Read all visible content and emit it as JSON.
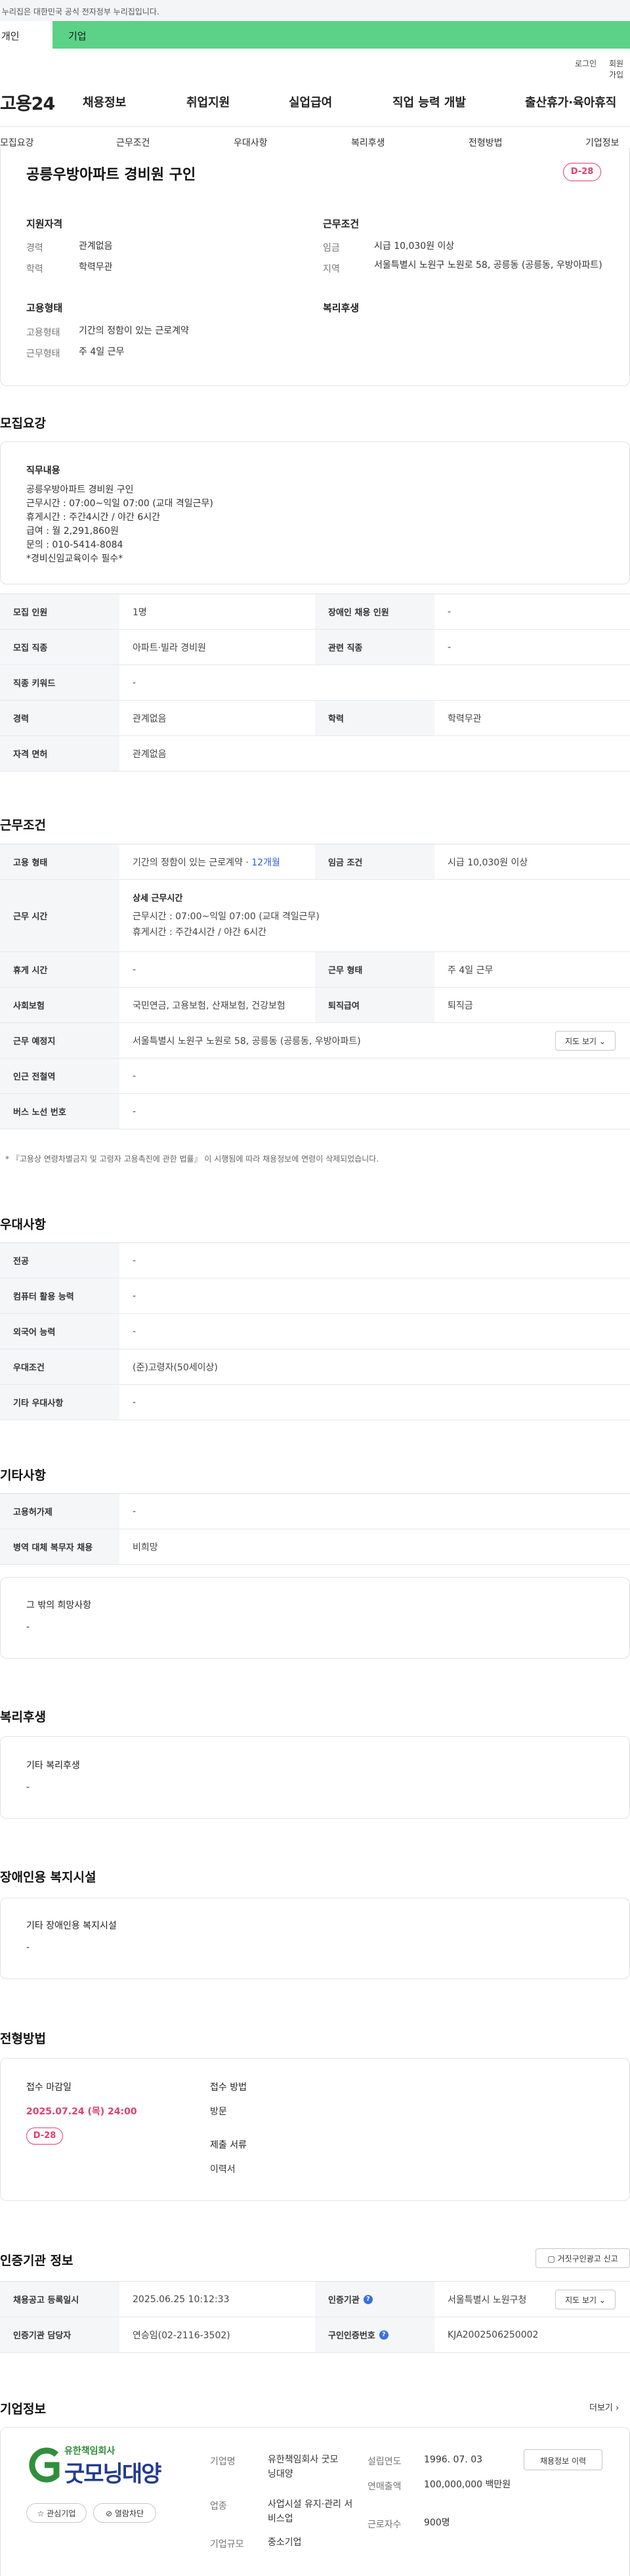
{
  "gov_banner": "이 누리집은 대한민국 공식 전자정부 누리집입니다.",
  "user_tabs": [
    "개인",
    "기업"
  ],
  "util_links": [
    "로그인",
    "회원가입"
  ],
  "logo": "고용24",
  "gnb": [
    "채용정보",
    "취업지원",
    "실업급여",
    "직업 능력 개발",
    "출산휴가·육아휴직"
  ],
  "section_nav": [
    "모집요강",
    "근무조건",
    "우대사항",
    "복리후생",
    "전형방법",
    "기업정보"
  ],
  "summary": {
    "title": "공릉우방아파트 경비원 구인",
    "dday": "D-28",
    "qualification": {
      "heading": "지원자격",
      "items": [
        {
          "k": "경력",
          "v": "관계없음"
        },
        {
          "k": "학력",
          "v": "학력무관"
        }
      ]
    },
    "conditions": {
      "heading": "근무조건",
      "items": [
        {
          "k": "임금",
          "v": "시급 10,030원 이상"
        },
        {
          "k": "지역",
          "v": "서울특별시 노원구 노원로 58, 공릉동 (공릉동, 우방아파트)"
        }
      ]
    },
    "employment": {
      "heading": "고용형태",
      "items": [
        {
          "k": "고용형태",
          "v": "기간의 정함이 있는 근로계약"
        },
        {
          "k": "근무형태",
          "v": "주 4일 근무"
        }
      ]
    },
    "welfare_heading": "복리후생"
  },
  "recruit": {
    "title": "모집요강",
    "duty_label": "직무내용",
    "duty_text": "공릉우방아파트 경비원 구인\n근무시간 : 07:00~익일 07:00 (교대 격일근무)\n휴게시간 : 주간4시간 / 야간 6시간\n급여 : 월 2,291,860원\n문의 : 010-5414-8084\n*경비신임교육이수 필수*",
    "table": [
      [
        {
          "th": "모집 인원",
          "td": "1명"
        },
        {
          "th": "장애인 채용 인원",
          "td": "-"
        }
      ],
      [
        {
          "th": "모집 직종",
          "td": "아파트·빌라 경비원"
        },
        {
          "th": "관련 직종",
          "td": "-"
        }
      ],
      [
        {
          "th": "직종 키워드",
          "td": "-"
        }
      ],
      [
        {
          "th": "경력",
          "td": "관계없음"
        },
        {
          "th": "학력",
          "td": "학력무관"
        }
      ],
      [
        {
          "th": "자격 면허",
          "td": "관계없음"
        }
      ]
    ]
  },
  "work": {
    "title": "근무조건",
    "employment_type_th": "고용 형태",
    "employment_type_td": "기간의 정함이 있는 근로계약 ·",
    "employment_months": "12개월",
    "wage_th": "임금 조건",
    "wage_td": "시급 10,030원 이상",
    "hours_th": "근무 시간",
    "hours_detail_label": "상세 근무시간",
    "hours_line1": "근무시간 : 07:00~익일 07:00 (교대 격일근무)",
    "hours_line2": "휴게시간 : 주간4시간 / 야간 6시간",
    "rest_th": "휴게 시간",
    "rest_td": "-",
    "shape_th": "근무 형태",
    "shape_td": "주 4일 근무",
    "insurance_th": "사회보험",
    "insurance_td": "국민연금, 고용보험, 산재보험, 건강보험",
    "severance_th": "퇴직급여",
    "severance_td": "퇴직금",
    "place_th": "근무 예정지",
    "place_td": "서울특별시 노원구 노원로 58, 공릉동 (공릉동, 우방아파트)",
    "map_btn": "지도 보기",
    "subway_th": "인근 전철역",
    "subway_td": "-",
    "bus_th": "버스 노선 번호",
    "bus_td": "-",
    "note": "* 『고용상 연령차별금지 및 고령자 고용촉진에 관한 법률』 이 시행됨에 따라 채용정보에 연령이 삭제되었습니다."
  },
  "preference": {
    "title": "우대사항",
    "rows": [
      {
        "th": "전공",
        "td": "-"
      },
      {
        "th": "컴퓨터 활용 능력",
        "td": "-"
      },
      {
        "th": "외국어 능력",
        "td": "-"
      },
      {
        "th": "우대조건",
        "td": "(준)고령자(50세이상)"
      },
      {
        "th": "기타 우대사항",
        "td": "-"
      }
    ]
  },
  "etc": {
    "title": "기타사항",
    "rows": [
      {
        "th": "고용허가제",
        "td": "-"
      },
      {
        "th": "병역 대체 복무자 채용",
        "td": "비희망"
      }
    ],
    "hope_label": "그 밖의 희망사항",
    "hope_value": "-"
  },
  "welfare": {
    "title": "복리후생",
    "label": "기타 복리후생",
    "value": "-"
  },
  "disability": {
    "title": "장애인용 복지시설",
    "label": "기타 장애인용 복지시설",
    "value": "-"
  },
  "selection": {
    "title": "전형방법",
    "deadline_label": "접수 마감일",
    "deadline_value": "2025.07.24 (목) 24:00",
    "dday": "D-28",
    "method_label": "접수 방법",
    "method_value": "방문",
    "docs_label": "제출 서류",
    "docs_value": "이력서"
  },
  "agency": {
    "title": "인증기관 정보",
    "report_btn": "거짓구인광고 신고",
    "row1": [
      {
        "th": "채용공고 등록일시",
        "td": "2025.06.25 10:12:33"
      },
      {
        "th": "인증기관",
        "td": "서울특별시 노원구청"
      }
    ],
    "row2": [
      {
        "th": "인증기관 담당자",
        "td": "연승임(02-2116-3502)"
      },
      {
        "th": "구인인증번호",
        "td": "KJA2002506250002"
      }
    ],
    "map_btn": "지도 보기"
  },
  "company": {
    "title": "기업정보",
    "more": "더보기",
    "logo_sub": "유한책임회사",
    "logo_main": "굿모닝대양",
    "fav_btn": "관심기업",
    "block_btn": "열람차단",
    "name_k": "기업명",
    "name_v": "유한책임회사 굿모닝대양",
    "biz_k": "업종",
    "biz_v": "사업시설 유지·관리 서비스업",
    "size_k": "기업규모",
    "size_v": "중소기업",
    "year_k": "설립연도",
    "year_v": "1996. 07. 03",
    "sales_k": "연매출액",
    "sales_v": "100,000,000 백만원",
    "emp_k": "근로자수",
    "emp_v": "900명",
    "jobs_btn": "채용정보 이력"
  },
  "colors": {
    "accent_green": "#5bd287",
    "dday_red": "#e43d6b",
    "link_blue": "#2a5fd6"
  }
}
